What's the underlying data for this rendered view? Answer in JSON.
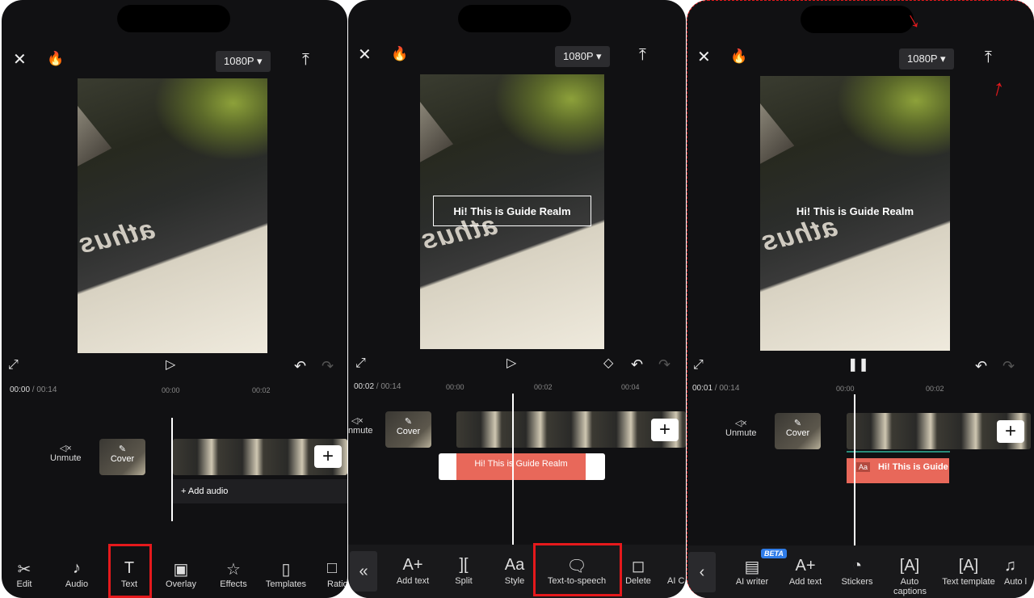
{
  "panels": [
    {
      "resolution": "1080P",
      "time_current": "00:00",
      "time_total": "00:14",
      "ticks": [
        "00:00",
        "00:02"
      ],
      "unmute": "Unmute",
      "cover": "Cover",
      "add_audio": "Add audio",
      "tools": [
        "Edit",
        "Audio",
        "Text",
        "Overlay",
        "Effects",
        "Templates",
        "Ratio"
      ],
      "highlighted_tool": "Text"
    },
    {
      "resolution": "1080P",
      "time_current": "00:02",
      "time_total": "00:14",
      "ticks": [
        "00:00",
        "00:02",
        "00:04"
      ],
      "unmute": "Unmute",
      "cover": "Cover",
      "overlay_text": "Hi! This is Guide Realm",
      "clip_text": "Hi! This is Guide Realm",
      "tools": [
        "Add text",
        "Split",
        "Style",
        "Text-to-speech",
        "Delete",
        "AI C"
      ],
      "highlighted_tool": "Text-to-speech"
    },
    {
      "resolution": "1080P",
      "time_current": "00:01",
      "time_total": "00:14",
      "ticks": [
        "00:00",
        "00:02"
      ],
      "unmute": "Unmute",
      "cover": "Cover",
      "overlay_text": "Hi! This is Guide Realm",
      "clip_text": "Hi! This is Guide",
      "tools": [
        "AI writer",
        "Add text",
        "Stickers",
        "Auto captions",
        "Text template",
        "Auto l"
      ],
      "beta_badge": "BETA"
    }
  ],
  "colors": {
    "accent_highlight": "#e5191c",
    "text_clip": "#e8685a",
    "background": "#111113"
  }
}
